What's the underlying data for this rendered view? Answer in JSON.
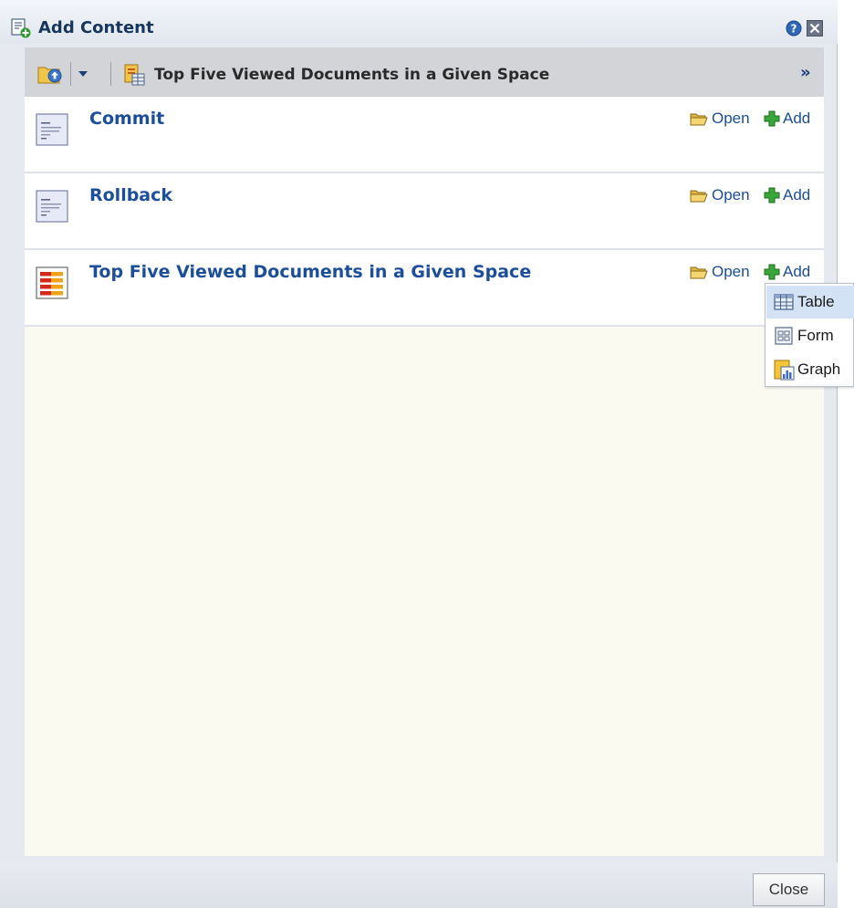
{
  "dialog": {
    "title": "Add Content",
    "title_icon": "add-content-icon",
    "help_icon": "help-icon",
    "close_icon": "close-icon"
  },
  "toolbar": {
    "up_icon": "folder-up-icon",
    "dropdown_icon": "chevron-down-icon",
    "path_icon": "report-document-icon",
    "path": "Top Five Viewed Documents in a Given Space",
    "more": "»"
  },
  "items": [
    {
      "name": "Commit",
      "icon": "text-document-icon",
      "open_label": "Open",
      "add_label": "Add"
    },
    {
      "name": "Rollback",
      "icon": "text-document-icon",
      "open_label": "Open",
      "add_label": "Add"
    },
    {
      "name": "Top Five Viewed Documents in a Given Space",
      "icon": "bar-report-icon",
      "open_label": "Open",
      "add_label": "Add"
    }
  ],
  "add_menu": {
    "highlighted": "Table",
    "items": [
      {
        "label": "Table",
        "icon": "table-icon"
      },
      {
        "label": "Form",
        "icon": "form-icon"
      },
      {
        "label": "Graph",
        "icon": "graph-icon"
      }
    ]
  },
  "footer": {
    "close_label": "Close"
  },
  "colors": {
    "link": "#1b4e9b",
    "title": "#17365d",
    "content_bg": "#fbfaf1",
    "menu_highlight": "#d3e3f5"
  }
}
